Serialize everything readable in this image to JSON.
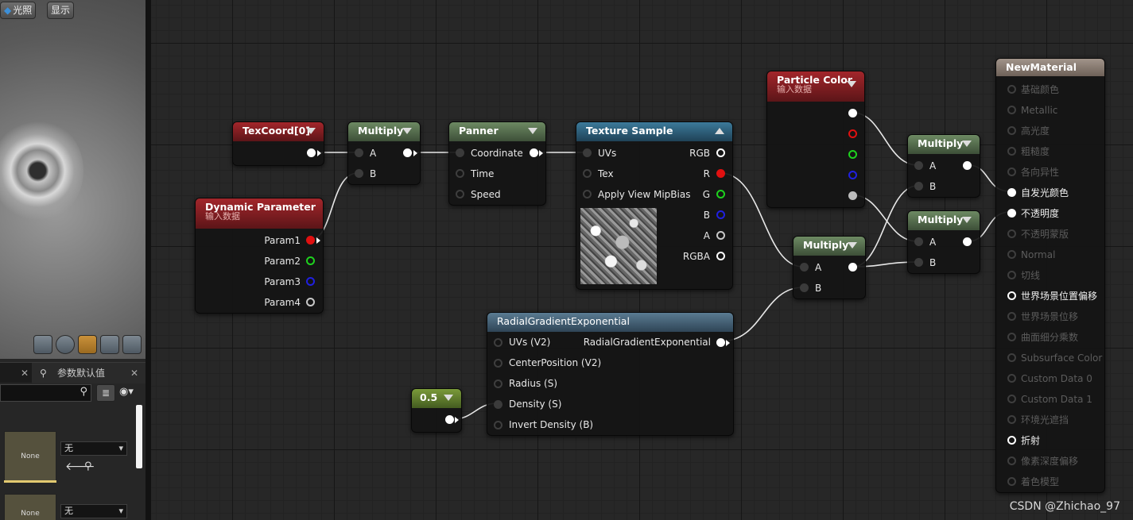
{
  "viewport": {
    "lighting_button": "光照",
    "show_button": "显示",
    "preview_shapes": [
      "cylinder",
      "sphere",
      "plane",
      "cube",
      "custom-mesh"
    ]
  },
  "panel": {
    "tab_label": "参数默认值",
    "items": [
      {
        "thumbnail": "None",
        "dropdown": "无"
      },
      {
        "thumbnail": "None",
        "dropdown": "无"
      }
    ]
  },
  "nodes": {
    "texcoord": {
      "title": "TexCoord[0]"
    },
    "multiply1": {
      "title": "Multiply",
      "inputs": [
        "A",
        "B"
      ]
    },
    "panner": {
      "title": "Panner",
      "inputs": [
        "Coordinate",
        "Time",
        "Speed"
      ]
    },
    "texture_sample": {
      "title": "Texture Sample",
      "inputs": [
        "UVs",
        "Tex",
        "Apply View MipBias"
      ],
      "outputs": [
        "RGB",
        "R",
        "G",
        "B",
        "A",
        "RGBA"
      ]
    },
    "dynamic_parameter": {
      "title": "Dynamic Parameter",
      "subtitle": "输入数据",
      "outputs": [
        "Param1",
        "Param2",
        "Param3",
        "Param4"
      ]
    },
    "particle_color": {
      "title": "Particle Color",
      "subtitle": "输入数据"
    },
    "multiply2": {
      "title": "Multiply",
      "inputs": [
        "A",
        "B"
      ]
    },
    "multiply3": {
      "title": "Multiply",
      "inputs": [
        "A",
        "B"
      ]
    },
    "multiply4": {
      "title": "Multiply",
      "inputs": [
        "A",
        "B"
      ]
    },
    "radial_gradient": {
      "title": "RadialGradientExponential",
      "inputs": [
        "UVs (V2)",
        "CenterPosition (V2)",
        "Radius (S)",
        "Density (S)",
        "Invert Density (B)"
      ],
      "output": "RadialGradientExponential"
    },
    "constant": {
      "title": "0.5"
    },
    "material": {
      "title": "NewMaterial",
      "pins": [
        {
          "label": "基础颜色",
          "active": false
        },
        {
          "label": "Metallic",
          "active": false
        },
        {
          "label": "高光度",
          "active": false
        },
        {
          "label": "粗糙度",
          "active": false
        },
        {
          "label": "各向异性",
          "active": false
        },
        {
          "label": "自发光颜色",
          "active": true
        },
        {
          "label": "不透明度",
          "active": true
        },
        {
          "label": "不透明蒙版",
          "active": false
        },
        {
          "label": "Normal",
          "active": false
        },
        {
          "label": "切线",
          "active": false
        },
        {
          "label": "世界场景位置偏移",
          "active": true
        },
        {
          "label": "世界场景位移",
          "active": false
        },
        {
          "label": "曲面细分乘数",
          "active": false
        },
        {
          "label": "Subsurface Color",
          "active": false
        },
        {
          "label": "Custom Data 0",
          "active": false
        },
        {
          "label": "Custom Data 1",
          "active": false
        },
        {
          "label": "环境光遮挡",
          "active": false
        },
        {
          "label": "折射",
          "active": true
        },
        {
          "label": "像素深度偏移",
          "active": false
        },
        {
          "label": "着色模型",
          "active": false
        }
      ]
    }
  },
  "watermark": "CSDN @Zhichao_97",
  "colors": {
    "node_red": "#a3262b",
    "node_green": "#6d8a63",
    "node_blue": "#3c7a9a",
    "pin_red": "#e01010",
    "pin_green": "#1ed21e",
    "pin_blue": "#2020e0"
  }
}
